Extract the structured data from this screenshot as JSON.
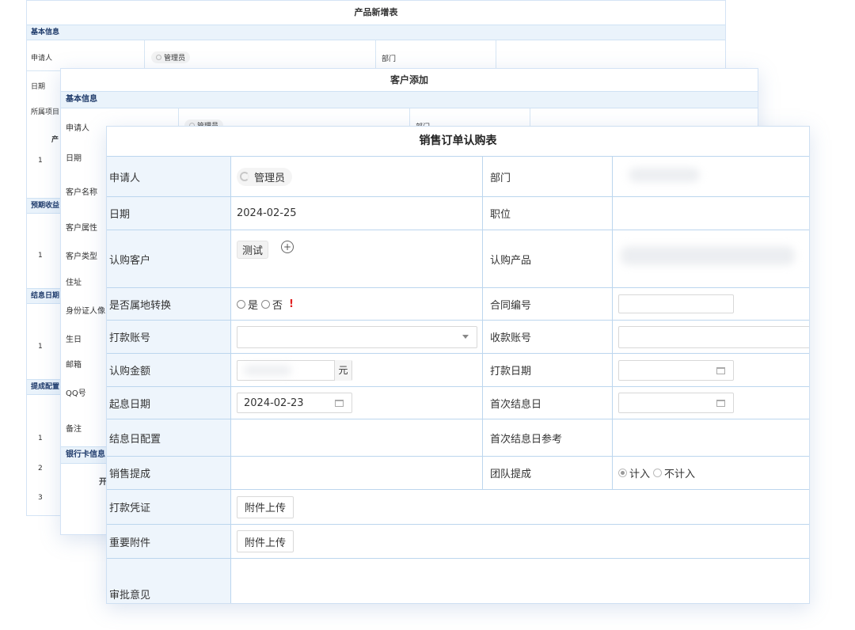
{
  "card_product": {
    "title": "产品新增表",
    "section_basic": "基本信息",
    "applicant_label": "申请人",
    "applicant_value": "管理员",
    "dept_label": "部门",
    "date_label": "日期",
    "project_label": "所属项目",
    "col_product": "产",
    "row_1": "1",
    "section_expected": "预期收益",
    "row_1b": "1",
    "section_settle": "结息日期",
    "row_1c": "1",
    "section_commission": "提成配置",
    "row_1d": "1",
    "row_2": "2",
    "row_3": "3"
  },
  "card_customer": {
    "title": "客户添加",
    "section_basic": "基本信息",
    "applicant_label": "申请人",
    "applicant_value": "管理员",
    "dept_label": "部门",
    "date_label": "日期",
    "customer_name_label": "客户名称",
    "customer_attr_label": "客户属性",
    "customer_type_label": "客户类型",
    "address_label": "住址",
    "id_photo_label": "身份证人像",
    "birthday_label": "生日",
    "email_label": "邮箱",
    "qq_label": "QQ号",
    "remark_label": "备注",
    "section_bank": "银行卡信息",
    "bank_col": "开"
  },
  "form": {
    "title": "销售订单认购表",
    "applicant_label": "申请人",
    "applicant_value": "管理员",
    "dept_label": "部门",
    "date_label": "日期",
    "date_value": "2024-02-25",
    "position_label": "职位",
    "customer_label": "认购客户",
    "customer_tag": "测试",
    "product_label": "认购产品",
    "convert_label": "是否属地转换",
    "convert_yes": "是",
    "convert_no": "否",
    "required_mark": "!",
    "contract_label": "合同编号",
    "pay_account_label": "打款账号",
    "receive_account_label": "收款账号",
    "amount_label": "认购金额",
    "amount_unit": "元",
    "pay_date_label": "打款日期",
    "start_date_label": "起息日期",
    "start_date_value": "2024-02-23",
    "first_settle_label": "首次结息日",
    "settle_config_label": "结息日配置",
    "first_settle_ref_label": "首次结息日参考",
    "sales_commission_label": "销售提成",
    "team_commission_label": "团队提成",
    "team_include": "计入",
    "team_exclude": "不计入",
    "pay_voucher_label": "打款凭证",
    "upload_label": "附件上传",
    "important_attach_label": "重要附件",
    "approval_label": "审批意见"
  }
}
